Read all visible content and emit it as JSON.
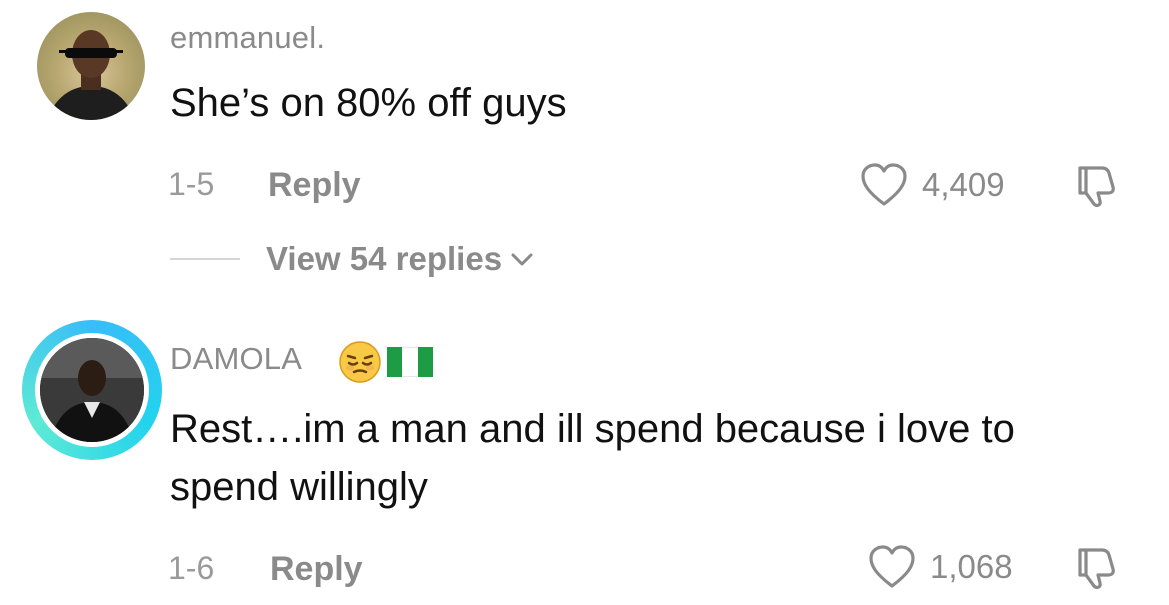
{
  "comments": [
    {
      "username": "emmanuel.",
      "text": "She’s on 80% off guys",
      "date": "1-5",
      "reply_label": "Reply",
      "likes": "4,409",
      "view_replies": "View 54 replies",
      "avatar_icon": "person-with-sunglasses"
    },
    {
      "username": "DAMOLA",
      "username_emoji": "😔",
      "username_flag": "nigeria-flag",
      "text": "Rest….im a man and ill spend because i love to spend willingly",
      "date": "1-6",
      "reply_label": "Reply",
      "likes": "1,068",
      "avatar_icon": "person-in-black-suit",
      "avatar_ring": true
    }
  ],
  "colors": {
    "text_primary": "#111111",
    "text_secondary": "#8a8a8a",
    "story_ring": "#38bdf8",
    "flag_green": "#1e9b45"
  }
}
